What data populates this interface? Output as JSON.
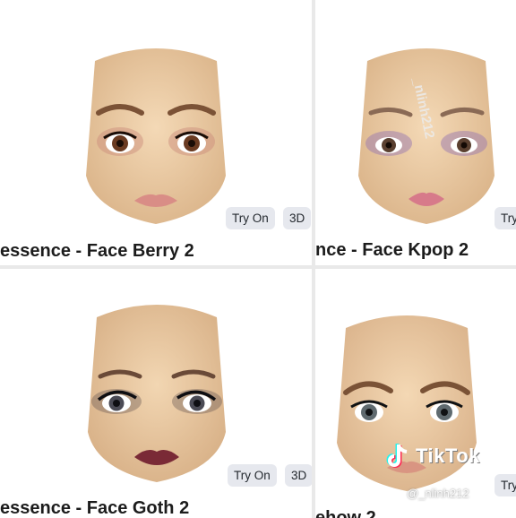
{
  "items": [
    {
      "title": "essence - Face Berry 2",
      "try_on": "Try On",
      "view3d": "3D"
    },
    {
      "title": "nce - Face Kpop 2",
      "try_on": "Try"
    },
    {
      "title": "essence - Face Goth 2",
      "try_on": "Try On",
      "view3d": "3D"
    },
    {
      "title": "ehow 2",
      "try_on": "Try On"
    }
  ],
  "watermark": {
    "vertical_text": "_nlinh212",
    "brand": "TikTok",
    "handle": "@_nlinh212"
  },
  "colors": {
    "skin": "#efcfa8",
    "button_bg": "#e6e8ee",
    "tiktok_cyan": "#25f4ee",
    "tiktok_red": "#fe2c55"
  }
}
